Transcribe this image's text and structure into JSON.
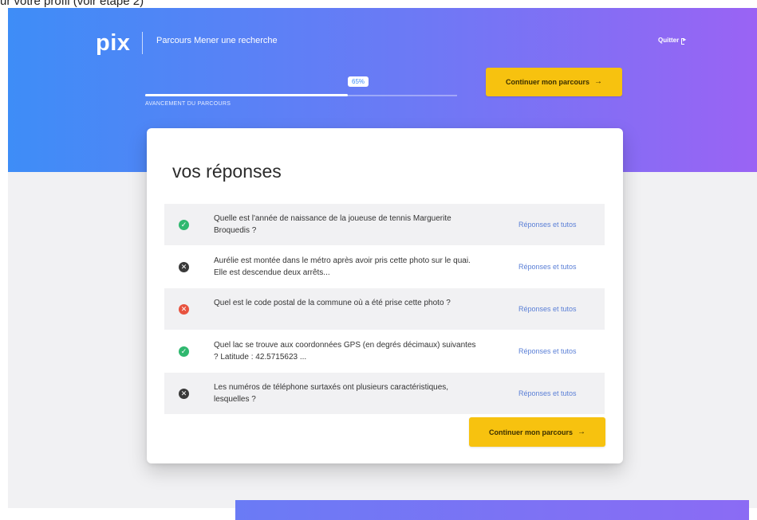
{
  "caption": "ur votre profil (voir étape 2)",
  "header": {
    "logo": "pix",
    "course_title": "Parcours Mener une recherche",
    "quit_label": "Quitter"
  },
  "progress": {
    "percent_label": "65%",
    "value": 0.65,
    "label": "AVANCEMENT DU PARCOURS"
  },
  "continue_label": "Continuer mon parcours",
  "card": {
    "title": "vos réponses",
    "answers": [
      {
        "status": "check-circle-icon",
        "question": "Quelle est l'année de naissance de la joueuse de tennis Marguerite Broquedis ?",
        "link": "Réponses et tutos"
      },
      {
        "status": "skip-circle-icon",
        "question": "Aurélie est montée dans le métro après avoir pris cette photo sur le quai. Elle est descendue deux arrêts...",
        "link": "Réponses et tutos"
      },
      {
        "status": "cross-circle-icon",
        "question": "Quel est le code postal de la commune où a été prise cette photo ?",
        "link": "Réponses et tutos"
      },
      {
        "status": "check-circle-icon",
        "question": "Quel lac se trouve aux coordonnées GPS (en degrés décimaux) suivantes ? Latitude : 42.5715623 ...",
        "link": "Réponses et tutos"
      },
      {
        "status": "skip-circle-icon",
        "question": "Les numéros de téléphone surtaxés ont plusieurs caractéristiques, lesquelles ?",
        "link": "Réponses et tutos"
      }
    ]
  },
  "colors": {
    "gradient_start": "#3e8df7",
    "gradient_end": "#9a63f4",
    "button_yellow": "#f7c20f",
    "ok_green": "#2fb86f",
    "ko_red": "#e8533f",
    "skip_dark": "#3a3a3a",
    "link_blue": "#5a7fd6"
  }
}
